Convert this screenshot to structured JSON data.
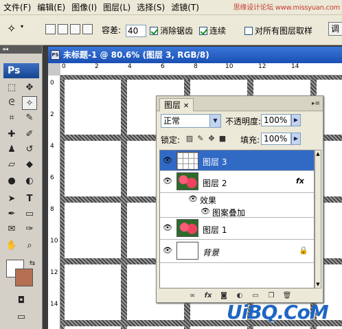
{
  "menubar": {
    "items": [
      "文件(F)",
      "编辑(E)",
      "图像(I)",
      "图层(L)",
      "选择(S)",
      "滤镜(T)"
    ],
    "watermark": "思缘设计论坛 www.missyuan.com"
  },
  "options": {
    "tolerance_label": "容差:",
    "tolerance_value": "40",
    "antialias_label": "消除锯齿",
    "contiguous_label": "连续",
    "sample_all_label": "对所有图层取样",
    "refine_label": "调"
  },
  "toolbox": {
    "logo": "Ps",
    "fg_color": "#ffffff",
    "bg_color": "#b56f52"
  },
  "document": {
    "title": "未标题-1 @ 80.6% (图层 3, RGB/8)",
    "ruler_h": [
      "0",
      "2",
      "4",
      "6",
      "8",
      "10",
      "12",
      "14"
    ],
    "ruler_v": [
      "0",
      "2",
      "4",
      "6",
      "8",
      "10",
      "12",
      "14"
    ]
  },
  "layers_panel": {
    "tab_label": "图层",
    "blend_mode": "正常",
    "opacity_label": "不透明度:",
    "opacity_value": "100%",
    "lock_label": "锁定:",
    "fill_label": "填充:",
    "fill_value": "100%",
    "layers": [
      {
        "name": "图层 3",
        "selected": true,
        "thumb": "grid"
      },
      {
        "name": "图层 2",
        "selected": false,
        "thumb": "flower",
        "fx": "fx"
      },
      {
        "name": "效果",
        "sub": true
      },
      {
        "name": "图案叠加",
        "sub": true
      },
      {
        "name": "图层 1",
        "selected": false,
        "thumb": "flower"
      },
      {
        "name": "背景",
        "selected": false,
        "thumb": "white",
        "locked": true
      }
    ]
  },
  "watermark_bottom": "UiBQ.CoM"
}
